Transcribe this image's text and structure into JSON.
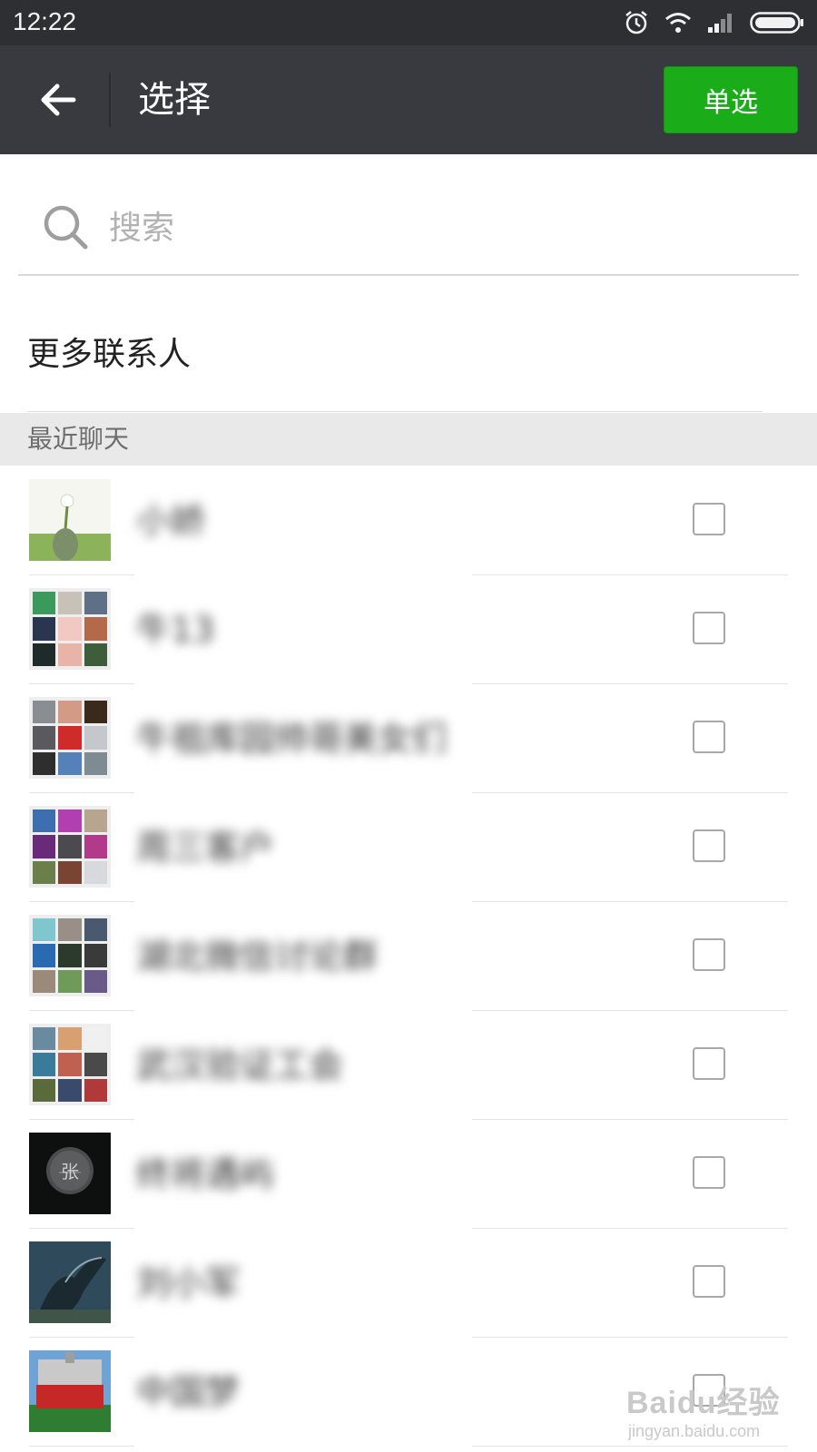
{
  "status_bar": {
    "time": "12:22"
  },
  "header": {
    "title": "选择",
    "single_select_label": "单选"
  },
  "search": {
    "placeholder": "搜索"
  },
  "more_contacts": {
    "label": "更多联系人"
  },
  "section": {
    "title": "最近聊天"
  },
  "chats": [
    {
      "name": "小娇",
      "avatar": "single-flower"
    },
    {
      "name": "牛13",
      "avatar": "group-grid"
    },
    {
      "name": "牛祖库园帅哥美女们",
      "avatar": "group-grid"
    },
    {
      "name": "周三客户",
      "avatar": "group-grid"
    },
    {
      "name": "湖北微信讨论群",
      "avatar": "group-grid"
    },
    {
      "name": "武汉验证工会",
      "avatar": "group-grid"
    },
    {
      "name": "终将遇屿",
      "avatar": "single-dark"
    },
    {
      "name": "刘小军",
      "avatar": "single-dragon"
    },
    {
      "name": "中国梦",
      "avatar": "single-garden"
    }
  ],
  "watermark": {
    "brand": "Baidu经验",
    "url": "jingyan.baidu.com"
  },
  "colors": {
    "header_bg": "#393a3f",
    "status_bg": "#2e2f33",
    "accent_green": "#1aad19",
    "section_bg": "#e9e9ea"
  }
}
